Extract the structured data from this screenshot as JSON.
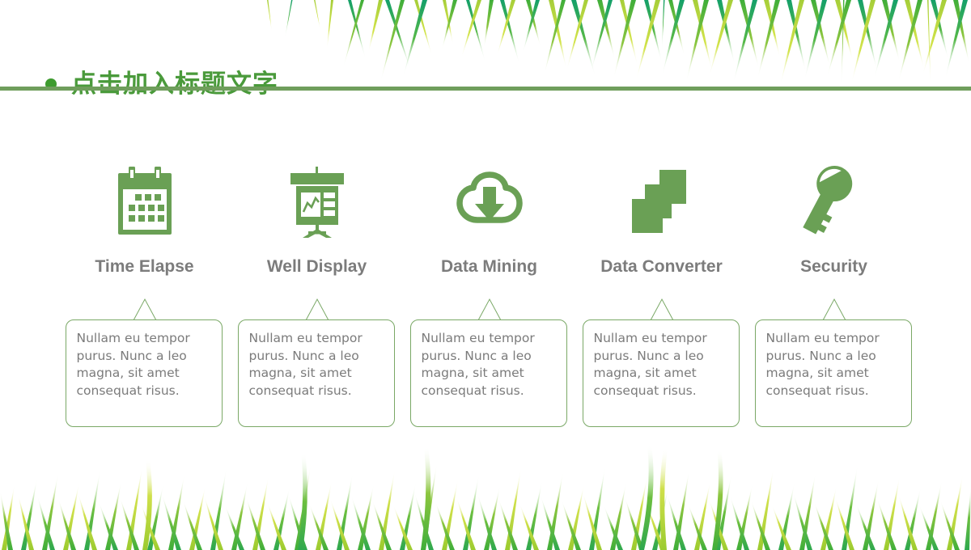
{
  "slide": {
    "background_color": "#ffffff",
    "accent_green": "#6aa055",
    "title_green": "#4a9a3b",
    "bullet_green": "#3d9b2e",
    "divider_green": "#6f9e5c",
    "label_gray": "#7c7c7c",
    "body_gray": "#7b7b7b",
    "bubble_border": "#7aa866"
  },
  "header": {
    "bullet_icon": "bullet-dot-icon",
    "title": "点击加入标题文字",
    "divider": "horizontal-rule"
  },
  "decoration": {
    "top": "grass-blades-hanging-top",
    "bottom": "grass-blades-standing-bottom"
  },
  "columns": [
    {
      "icon": "calendar-icon",
      "label": "Time Elapse",
      "body": "Nullam eu tempor purus. Nunc a leo magna, sit amet consequat risus."
    },
    {
      "icon": "presentation-chart-icon",
      "label": "Well Display",
      "body": "Nullam eu tempor purus. Nunc a leo magna, sit amet consequat risus."
    },
    {
      "icon": "cloud-download-icon",
      "label": "Data Mining",
      "body": "Nullam eu tempor purus. Nunc a leo magna, sit amet consequat risus."
    },
    {
      "icon": "stacked-layers-icon",
      "label": "Data Converter",
      "body": "Nullam eu tempor purus. Nunc a leo magna, sit amet consequat risus."
    },
    {
      "icon": "key-icon",
      "label": "Security",
      "body": "Nullam eu tempor purus. Nunc a leo magna, sit amet consequat risus."
    }
  ]
}
